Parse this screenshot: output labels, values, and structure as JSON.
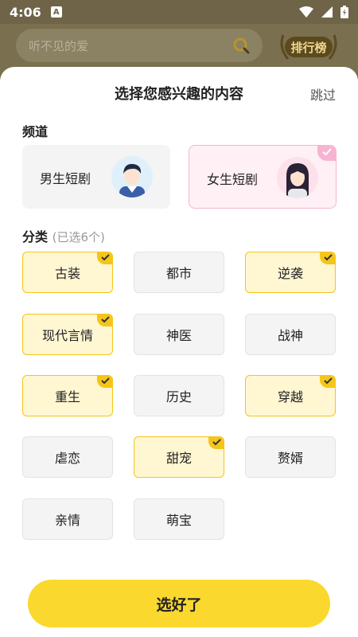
{
  "status_bar": {
    "time": "4:06",
    "notification_icon": "A"
  },
  "background": {
    "search_placeholder": "听不见的爱",
    "rank_label": "排行榜"
  },
  "sheet": {
    "title": "选择您感兴趣的内容",
    "skip_label": "跳过",
    "channel_section": "频道",
    "channels": [
      {
        "label": "男生短剧",
        "selected": false
      },
      {
        "label": "女生短剧",
        "selected": true
      }
    ],
    "category_section": "分类",
    "category_hint": "(已选6个)",
    "categories": [
      {
        "label": "古装",
        "selected": true
      },
      {
        "label": "都市",
        "selected": false
      },
      {
        "label": "逆袭",
        "selected": true
      },
      {
        "label": "现代言情",
        "selected": true
      },
      {
        "label": "神医",
        "selected": false
      },
      {
        "label": "战神",
        "selected": false
      },
      {
        "label": "重生",
        "selected": true
      },
      {
        "label": "历史",
        "selected": false
      },
      {
        "label": "穿越",
        "selected": true
      },
      {
        "label": "虐恋",
        "selected": false
      },
      {
        "label": "甜宠",
        "selected": true
      },
      {
        "label": "赘婿",
        "selected": false
      },
      {
        "label": "亲情",
        "selected": false
      },
      {
        "label": "萌宝",
        "selected": false
      }
    ],
    "confirm_label": "选好了"
  },
  "colors": {
    "accent": "#fad82e",
    "selected_border": "#f5c518",
    "pink": "#f7b4d2"
  }
}
